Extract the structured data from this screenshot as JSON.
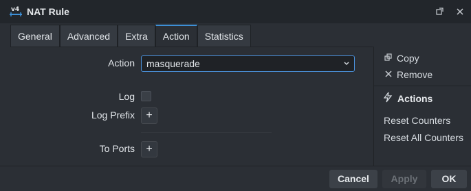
{
  "window": {
    "title": "NAT Rule",
    "app_icon_text": "v4"
  },
  "titlebar": {
    "restore_icon": "restore-icon",
    "close_icon": "close-icon"
  },
  "tabs": [
    {
      "label": "General"
    },
    {
      "label": "Advanced"
    },
    {
      "label": "Extra"
    },
    {
      "label": "Action",
      "active": true
    },
    {
      "label": "Statistics"
    }
  ],
  "form": {
    "action_label": "Action",
    "action_value": "masquerade",
    "log_label": "Log",
    "log_checked": false,
    "log_prefix_label": "Log Prefix",
    "to_ports_label": "To Ports"
  },
  "sidebar": {
    "copy_label": "Copy",
    "remove_label": "Remove",
    "actions_header": "Actions",
    "reset_counters_label": "Reset Counters",
    "reset_all_counters_label": "Reset All Counters"
  },
  "footer": {
    "cancel_label": "Cancel",
    "apply_label": "Apply",
    "ok_label": "OK"
  },
  "colors": {
    "accent": "#3d8fd6",
    "window_bg": "#2b2f35",
    "titlebar_bg": "#22262b"
  }
}
